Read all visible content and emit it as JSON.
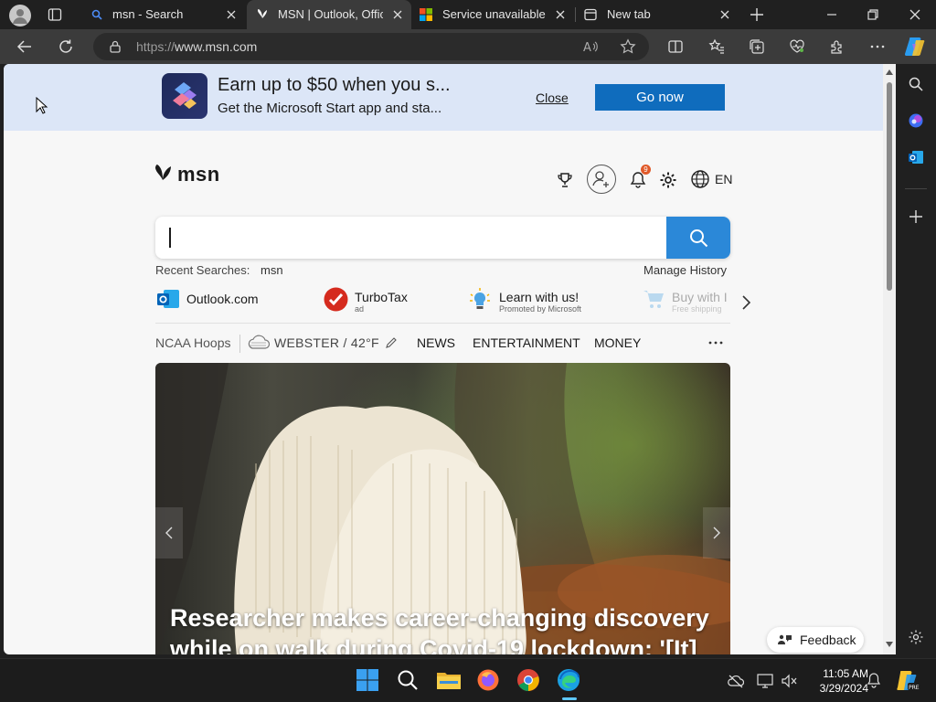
{
  "browser": {
    "tabs": [
      {
        "title": "msn - Search",
        "active": false
      },
      {
        "title": "MSN | Outlook, Office",
        "active": true
      },
      {
        "title": "Service unavailable",
        "active": false
      },
      {
        "title": "New tab",
        "active": false
      }
    ],
    "address": {
      "prefix": "https://",
      "host": "www.msn.com"
    }
  },
  "banner": {
    "headline": "Earn up to $50 when you s...",
    "subline": "Get the Microsoft Start app and sta...",
    "close_label": "Close",
    "cta_label": "Go now"
  },
  "header": {
    "logo_text": "msn",
    "notification_count": "9",
    "language": "EN"
  },
  "search": {
    "recent_label": "Recent Searches:",
    "recent_items": [
      "msn"
    ],
    "manage_history": "Manage History"
  },
  "quick_links": [
    {
      "label": "Outlook.com",
      "sub": ""
    },
    {
      "label": "TurboTax",
      "sub": "ad"
    },
    {
      "label": "Learn with us!",
      "sub": "Promoted by Microsoft"
    },
    {
      "label": "Buy with I",
      "sub": "Free shipping"
    }
  ],
  "nav": {
    "topic": "NCAA Hoops",
    "weather": "WEBSTER / 42°F",
    "items": [
      "NEWS",
      "ENTERTAINMENT",
      "MONEY"
    ]
  },
  "hero": {
    "title_line1": "Researcher makes career-changing discovery",
    "title_line2": "while on walk during Covid-19 lockdown: '[It]"
  },
  "feedback_label": "Feedback",
  "taskbar": {
    "time": "11:05 AM",
    "date": "3/29/2024"
  },
  "colors": {
    "accent": "#0f6cbd",
    "search_button": "#2b88d8",
    "banner_bg": "#dce6f7",
    "tab_active": "#3b3b3b"
  }
}
